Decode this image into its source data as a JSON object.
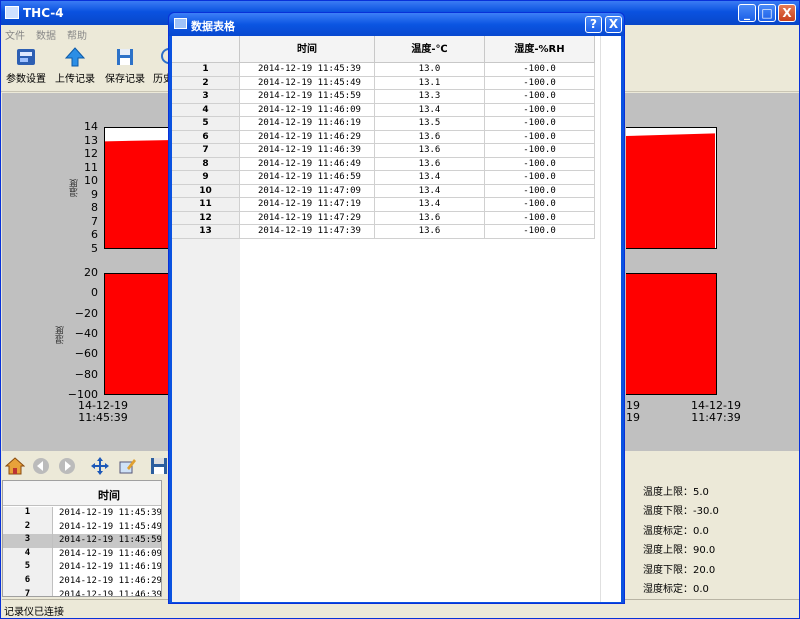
{
  "main_window": {
    "title": "THC-4",
    "menu": [
      "文件",
      "数据",
      "帮助"
    ],
    "toolbar": [
      "参数设置",
      "上传记录",
      "保存记录",
      "历史"
    ],
    "status": "记录仪已连接",
    "win_buttons": [
      "_",
      "□",
      "X"
    ]
  },
  "chart_data": [
    {
      "type": "area",
      "ylabel": "温度",
      "ylim": [
        5,
        14
      ],
      "yticks": [
        "14",
        "13",
        "12",
        "11",
        "10",
        "9",
        "8",
        "7",
        "6",
        "5"
      ],
      "fill_color": "#ff0000",
      "x_visible": [
        "14-12-19 11:45:39",
        "14-12-19 11:47:39"
      ]
    },
    {
      "type": "area",
      "ylabel": "湿度",
      "ylim": [
        -100,
        20
      ],
      "yticks": [
        "20",
        "0",
        "−20",
        "−40",
        "−60",
        "−80",
        "−100"
      ],
      "fill_color": "#ff0000",
      "x_labels": [
        {
          "date": "14-12-19",
          "time": "11:45:39"
        },
        {
          "date": "14-12-19",
          "time": "11:47:39"
        }
      ],
      "x_labels_partial": [
        {
          "date": "19",
          "time": "19"
        }
      ]
    }
  ],
  "bottom_table": {
    "header": "时间",
    "rows": [
      {
        "n": "1",
        "t": "2014-12-19 11:45:39"
      },
      {
        "n": "2",
        "t": "2014-12-19 11:45:49"
      },
      {
        "n": "3",
        "t": "2014-12-19 11:45:59"
      },
      {
        "n": "4",
        "t": "2014-12-19 11:46:09"
      },
      {
        "n": "5",
        "t": "2014-12-19 11:46:19"
      },
      {
        "n": "6",
        "t": "2014-12-19 11:46:29"
      },
      {
        "n": "7",
        "t": "2014-12-19 11:46:39"
      }
    ],
    "selected_row": "3"
  },
  "limits": [
    "温度上限：5.0",
    "温度下限：-30.0",
    "温度标定：0.0",
    "湿度上限：90.0",
    "湿度下限：20.0",
    "湿度标定：0.0"
  ],
  "dialog": {
    "title": "数据表格",
    "help": "?",
    "close": "X",
    "headers": [
      "时间",
      "温度-℃",
      "湿度-%RH"
    ],
    "rows": [
      {
        "n": "1",
        "time": "2014-12-19 11:45:39",
        "temp": "13.0",
        "hum": "-100.0"
      },
      {
        "n": "2",
        "time": "2014-12-19 11:45:49",
        "temp": "13.1",
        "hum": "-100.0"
      },
      {
        "n": "3",
        "time": "2014-12-19 11:45:59",
        "temp": "13.3",
        "hum": "-100.0"
      },
      {
        "n": "4",
        "time": "2014-12-19 11:46:09",
        "temp": "13.4",
        "hum": "-100.0"
      },
      {
        "n": "5",
        "time": "2014-12-19 11:46:19",
        "temp": "13.5",
        "hum": "-100.0"
      },
      {
        "n": "6",
        "time": "2014-12-19 11:46:29",
        "temp": "13.6",
        "hum": "-100.0"
      },
      {
        "n": "7",
        "time": "2014-12-19 11:46:39",
        "temp": "13.6",
        "hum": "-100.0"
      },
      {
        "n": "8",
        "time": "2014-12-19 11:46:49",
        "temp": "13.6",
        "hum": "-100.0"
      },
      {
        "n": "9",
        "time": "2014-12-19 11:46:59",
        "temp": "13.4",
        "hum": "-100.0"
      },
      {
        "n": "10",
        "time": "2014-12-19 11:47:09",
        "temp": "13.4",
        "hum": "-100.0"
      },
      {
        "n": "11",
        "time": "2014-12-19 11:47:19",
        "temp": "13.4",
        "hum": "-100.0"
      },
      {
        "n": "12",
        "time": "2014-12-19 11:47:29",
        "temp": "13.6",
        "hum": "-100.0"
      },
      {
        "n": "13",
        "time": "2014-12-19 11:47:39",
        "temp": "13.6",
        "hum": "-100.0"
      }
    ]
  }
}
